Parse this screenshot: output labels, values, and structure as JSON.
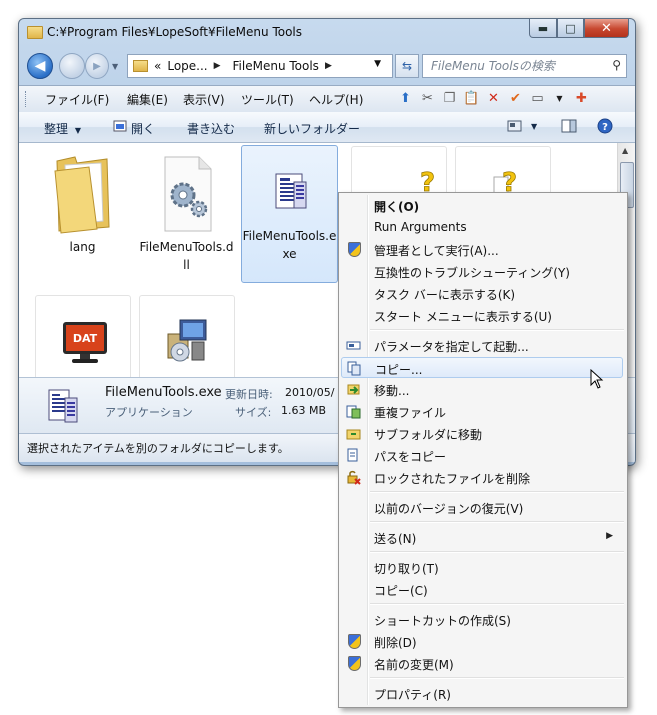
{
  "window": {
    "title": "C:¥Program Files¥LopeSoft¥FileMenu Tools",
    "buttons": {
      "minimize": "▬",
      "maximize": "□",
      "close": "✕"
    }
  },
  "nav": {
    "breadcrumb": [
      "«",
      "Lope...",
      "FileMenu Tools"
    ],
    "search_placeholder": "FileMenu Toolsの検索"
  },
  "menubar": {
    "items": [
      "ファイル(F)",
      "編集(E)",
      "表示(V)",
      "ツール(T)",
      "ヘルプ(H)"
    ]
  },
  "cmdbar": {
    "organize": "整理",
    "open": "開く",
    "burn": "書き込む",
    "new_folder": "新しいフォルダー"
  },
  "files": [
    {
      "label": "lang",
      "icon": "folder-icon"
    },
    {
      "label": "FileMenuTools.dll",
      "icon": "dll-gear-icon"
    },
    {
      "label": "FileMenuTools.exe",
      "icon": "exe-document-icon",
      "selected": true
    },
    {
      "label": "",
      "icon": "unknown-file-icon"
    },
    {
      "label": "",
      "icon": "unknown-file-icon"
    },
    {
      "label": "",
      "icon": "dat-monitor-icon"
    },
    {
      "label": "",
      "icon": "installer-icon"
    }
  ],
  "details": {
    "name": "FileMenuTools.exe",
    "modified_label": "更新日時:",
    "modified_value": "2010/05/",
    "type": "アプリケーション",
    "size_label": "サイズ:",
    "size_value": "1.63 MB"
  },
  "status": "選択されたアイテムを別のフォルダにコピーします。",
  "context_menu": {
    "items": [
      {
        "label": "開く(O)",
        "bold": true
      },
      {
        "label": "Run Arguments"
      },
      {
        "label": "管理者として実行(A)...",
        "icon": "shield-icon"
      },
      {
        "label": "互換性のトラブルシューティング(Y)"
      },
      {
        "label": "タスク バーに表示する(K)"
      },
      {
        "label": "スタート メニューに表示する(U)"
      },
      {
        "label": "パラメータを指定して起動...",
        "icon": "parameter-icon"
      },
      {
        "label": "コピー...",
        "icon": "copy-icon",
        "highlighted": true
      },
      {
        "label": "移動...",
        "icon": "move-icon"
      },
      {
        "label": "重複ファイル",
        "icon": "duplicate-icon"
      },
      {
        "label": "サブフォルダに移動",
        "icon": "subfolder-icon"
      },
      {
        "label": "パスをコピー",
        "icon": "copy-path-icon"
      },
      {
        "label": "ロックされたファイルを削除",
        "icon": "unlock-delete-icon"
      },
      {
        "label": "以前のバージョンの復元(V)"
      },
      {
        "label": "送る(N)",
        "submenu": true
      },
      {
        "label": "切り取り(T)"
      },
      {
        "label": "コピー(C)"
      },
      {
        "label": "ショートカットの作成(S)"
      },
      {
        "label": "削除(D)",
        "icon": "shield-icon"
      },
      {
        "label": "名前の変更(M)",
        "icon": "shield-icon"
      },
      {
        "label": "プロパティ(R)"
      }
    ]
  }
}
